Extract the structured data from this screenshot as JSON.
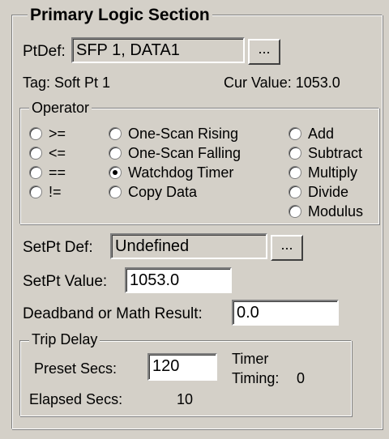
{
  "primary": {
    "title": "Primary Logic Section"
  },
  "ptdef": {
    "label": "PtDef:",
    "value": "SFP 1, DATA1",
    "browse": "..."
  },
  "tag": {
    "text": "Tag: Soft Pt 1"
  },
  "cur_value": {
    "text": "Cur Value: 1053.0"
  },
  "operator": {
    "title": "Operator",
    "col1": [
      ">=",
      "<=",
      "==",
      "!="
    ],
    "col2": [
      "One-Scan Rising",
      "One-Scan Falling",
      "Watchdog Timer",
      "Copy Data"
    ],
    "col3": [
      "Add",
      "Subtract",
      "Multiply",
      "Divide",
      "Modulus"
    ],
    "selected": "Watchdog Timer"
  },
  "setpt_def": {
    "label": "SetPt Def:",
    "value": "Undefined",
    "browse": "..."
  },
  "setpt_value": {
    "label": "SetPt Value:",
    "value": "1053.0"
  },
  "deadband": {
    "label": "Deadband or Math Result:",
    "value": "0.0"
  },
  "trip_delay": {
    "title": "Trip Delay",
    "preset_label": "Preset Secs:",
    "preset_value": "120",
    "timer_label": "Timer",
    "timing_label": "Timing:",
    "timing_value": "0",
    "elapsed_label": "Elapsed Secs:",
    "elapsed_value": "10"
  }
}
